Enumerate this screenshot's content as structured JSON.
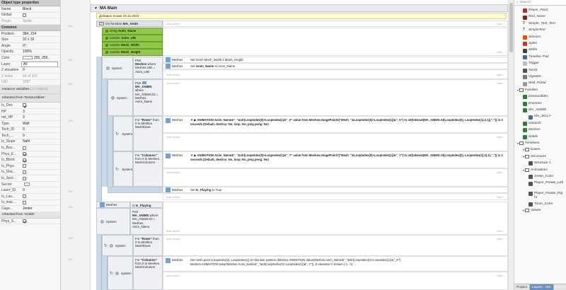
{
  "left_panel": {
    "title": "Object type properties",
    "name_label": "Name",
    "name_value": "Block",
    "global_label": "Global",
    "plugin_label": "Plugin",
    "plugin_value": "Sprite",
    "common_header": "Common",
    "position_label": "Position",
    "position_value": "384, 224",
    "size_label": "Size",
    "size_value": "32 x 32",
    "angle_label": "Angle",
    "angle_value": "0°",
    "opacity_label": "Opacity",
    "opacity_value": "100%",
    "color_label": "Color",
    "color_value": "255, 255,",
    "layer_label": "Layer",
    "layer_value": "All",
    "zelev_label": "Z elevation",
    "zelev_value": "0",
    "zindex_label": "Z index",
    "zindex_value": "64 of 102",
    "uid_label": "UID",
    "uid_value": "1097",
    "instvars_label": "Instance variables",
    "instvars_extra": "(12 hidden)",
    "inherited_destructibles": "Inherited from 'Destructibles'",
    "vars": [
      {
        "label": "Is_Des",
        "value": "",
        "checked": true,
        "type": "check"
      },
      {
        "label": "HP",
        "value": "3",
        "type": "text"
      },
      {
        "label": "mit_HP",
        "value": "3",
        "type": "text"
      },
      {
        "label": "Type",
        "value": "Wall",
        "type": "text"
      },
      {
        "label": "Tech_ID",
        "value": "0",
        "type": "text"
      },
      {
        "label": "Tech_...",
        "value": "0",
        "type": "text"
      },
      {
        "label": "Is_Slope",
        "value": "NaN",
        "type": "text"
      },
      {
        "label": "Is_Bou...",
        "value": "",
        "checked": false,
        "type": "check"
      },
      {
        "label": "Phys_E...",
        "value": "",
        "checked": true,
        "type": "check"
      },
      {
        "label": "Is_Block",
        "value": "",
        "checked": true,
        "type": "check"
      },
      {
        "label": "Is_Phys",
        "value": "",
        "checked": false,
        "type": "check"
      },
      {
        "label": "Is_Sha...",
        "value": "",
        "checked": false,
        "type": "check"
      },
      {
        "label": "Is_Sect...",
        "value": "",
        "checked": false,
        "type": "check"
      },
      {
        "label": "Secret",
        "value": "",
        "type": "button"
      },
      {
        "label": "Laser_ID",
        "value": "0",
        "type": "text"
      },
      {
        "label": "Is_Las...",
        "value": "",
        "checked": false,
        "type": "check"
      },
      {
        "label": "Is_insp...",
        "value": "",
        "checked": false,
        "type": "check"
      },
      {
        "label": "Cage...",
        "value": "Jester",
        "type": "text"
      }
    ],
    "inherited_solids": "Inherited from 'Solids'",
    "phys_label": "Phys_S..."
  },
  "line_numbers": [
    "140",
    "141",
    "142",
    "143",
    "144",
    "145",
    "146",
    "147",
    "148",
    "149",
    "150",
    "151",
    "152"
  ],
  "group": {
    "title": "MA Main"
  },
  "comment": "Добавил позже 28.11.2022",
  "function_event": {
    "label": "On function",
    "name": "MA_Anim"
  },
  "params": [
    {
      "type": "string",
      "name": "Anim_Name"
    },
    {
      "type": "number",
      "name": "Anim_UID"
    },
    {
      "type": "number",
      "name": "Mesh_Width"
    },
    {
      "type": "number",
      "name": "Mesh_Height"
    }
  ],
  "add_action": "Add action",
  "add": "Add...",
  "sub1": {
    "obj": "System",
    "pick_prefix": "Pick",
    "pick_obj": "Meshes",
    "pick_rest": "where Meshes.UID = Anim_UID",
    "act1_obj": "Meshes",
    "act1_text": "Set mesh Mesh_Width x Mesh_Height",
    "act2_obj": "Meshes",
    "act2_prefix": "Set",
    "act2_var": "Anim_Name",
    "act2_rest": "to Anim_Name"
  },
  "sub2": {
    "obj": "System",
    "pick_prefix": "Pick",
    "pick_obj": "MA_ANIMS",
    "pick_rest": "where MA_ANIMS.ID = Meshes. Anim_Name"
  },
  "sub3": {
    "obj": "System",
    "for_prefix": "For",
    "for_name": "\"Rows\"",
    "for_rest": "from 0 to Meshes. MeshRows",
    "act_obj": "Meshes",
    "act_text": "▼ ▶ ANIMATION Anim_Name&\"_\"&str(LoopIndex(0)+LoopIndex(1)&\"_X\" value from Meshes.ImagePointX(\"Mesh_\"&LoopIndex(0)+LoopIndex(1))&\"_X\") to int(tokenat(MA_ANIMS.At(LoopIndex(0), LoopIndex(1),0,1)),\",\")) in 2 seconds (Default, destroy: No, loop: No, ping pong: No)"
  },
  "sub4": {
    "obj": "System",
    "for_prefix": "For",
    "for_name": "\"Columns\"",
    "for_rest": "from 0 to Meshes. MeshColumns",
    "act_obj": "Meshes",
    "act_text": "▼ ▶ ANIMATION Anim_Name&\"_\"&str(LoopIndex(0)+LoopIndex(1)&\"_Y\" value from Meshes.ImagePointY(\"Mesh_\"&LoopIndex(0)+LoopIndex(1))&\"_Y\") to int(tokenat(MA_ANIMS.At(LoopIndex(0), LoopIndex(1),1),1),\",\")) in 2 seconds (Default, destroy: No, loop: No, ping pong: No)"
  },
  "isplaying_act": {
    "obj": "Meshes",
    "prefix": "Set",
    "var": "Is_Playing",
    "rest": "to True"
  },
  "ev2": {
    "cond1_obj": "Meshes",
    "cond1_prefix": "Is",
    "cond1_var": "Is_Playing",
    "cond2_obj": "System",
    "cond2_prefix": "Pick",
    "cond2_name": "MA_ANIMS",
    "cond2_rest": "where MA_ANIMS.ID = Meshes. Anim_Name"
  },
  "ev3": {
    "obj": "System",
    "for_prefix": "For",
    "for_name": "\"Rows\"",
    "for_rest": "from 0 to Meshes. MeshRows"
  },
  "ev4": {
    "obj": "System",
    "for_prefix": "For",
    "for_name": "\"Columns\"",
    "for_rest": "from 0 to Meshes. MeshColumns",
    "act_obj": "Meshes",
    "act_text": "Set mesh point (LoopIndex(0), LoopIndex(1)) to Absolute position (Meshes.ANIMATION.Value(Meshes.Anim_Name&\"_\"&str(LoopIndex(0)+LoopIndex(1))&\"_X\"), Meshes.ANIMATION.Value(Meshes.Anim_Name&\"_\"&str(LoopIndex(0)+LoopIndex(1))&\"_Y\")), Z elevation 0, texture (-1, -1)"
  },
  "right_panel": {
    "search_placeholder": "Search",
    "items": [
      {
        "label": "Player_Point",
        "type": "icon",
        "color": "#c62828",
        "indent": 1,
        "italic": true
      },
      {
        "label": "Red_Noise",
        "type": "icon",
        "color": "#8b1a1a",
        "indent": 1,
        "italic": true
      },
      {
        "label": "Simple_Text_Text",
        "type": "text",
        "indent": 1,
        "italic": true
      },
      {
        "label": "SimpleText",
        "type": "text",
        "indent": 1,
        "italic": true
      },
      {
        "label": "Sensors",
        "type": "icon",
        "color": "#e65100",
        "indent": 1,
        "italic": true
      },
      {
        "label": "Spike",
        "type": "icon",
        "color": "#d32f2f",
        "indent": 1,
        "italic": true
      },
      {
        "label": "Strike",
        "type": "icon",
        "color": "#444444",
        "indent": 1,
        "italic": true
      },
      {
        "label": "Timeline Trail",
        "type": "icon",
        "color": "#3a6ea5",
        "indent": 1,
        "italic": true
      },
      {
        "label": "Trigger",
        "type": "icon",
        "color": "#bbbbbb",
        "indent": 1,
        "italic": true
      },
      {
        "label": "Turret",
        "type": "icon",
        "color": "#555555",
        "indent": 1,
        "italic": true
      },
      {
        "label": "Vignette",
        "type": "icon",
        "color": "#777777",
        "indent": 1,
        "italic": true
      },
      {
        "label": "Wall_Portal",
        "type": "icon",
        "color": "#999999",
        "indent": 1,
        "italic": true
      },
      {
        "label": "Families",
        "type": "folder",
        "indent": 0,
        "italic": false
      },
      {
        "label": "Destructibles",
        "type": "icon",
        "color": "#2e7d32",
        "indent": 1,
        "italic": true
      },
      {
        "label": "Enemies",
        "type": "icon",
        "color": "#2e7d32",
        "indent": 1,
        "italic": true
      },
      {
        "label": "MA_ANIMS",
        "type": "icon",
        "color": "#2e7d32",
        "indent": 1,
        "italic": true
      },
      {
        "label": "MA_JELLY",
        "type": "icon",
        "color": "#3a6ea5",
        "indent": 2,
        "italic": false
      },
      {
        "label": "Hazards",
        "type": "icon",
        "color": "#2e7d32",
        "indent": 1,
        "italic": true
      },
      {
        "label": "Meshes",
        "type": "icon",
        "color": "#2e7d32",
        "indent": 1,
        "italic": true
      },
      {
        "label": "Solids",
        "type": "icon",
        "color": "#2e7d32",
        "indent": 1,
        "italic": true
      },
      {
        "label": "Timelines",
        "type": "folder",
        "indent": 0,
        "italic": false
      },
      {
        "label": "Eases",
        "type": "folder",
        "indent": 1,
        "italic": false
      },
      {
        "label": "Structures",
        "type": "folder",
        "indent": 1,
        "italic": false
      },
      {
        "label": "Structure 1",
        "type": "icon",
        "color": "#555555",
        "indent": 2,
        "italic": false
      },
      {
        "label": "Animations",
        "type": "folder",
        "indent": 1,
        "italic": false
      },
      {
        "label": "Jester_Color",
        "type": "icon",
        "color": "#555555",
        "indent": 2,
        "italic": false
      },
      {
        "label": "Player_Rotate_Left",
        "type": "icon",
        "color": "#555555",
        "indent": 2,
        "italic": false
      },
      {
        "label": "Player_Rotate_Right",
        "type": "icon",
        "color": "#555555",
        "indent": 2,
        "italic": false
      },
      {
        "label": "Timer_Color",
        "type": "icon",
        "color": "#555555",
        "indent": 2,
        "italic": false
      },
      {
        "label": "Values",
        "type": "folder",
        "indent": 1,
        "italic": false
      }
    ],
    "tab_project": "Project",
    "tab_layers": "Layers - UID"
  },
  "colors": {
    "group_bar": "#e8eaef",
    "local_var": "#92c84a",
    "comment": "#fffbd0",
    "tab_active": "#6a8fbf"
  }
}
